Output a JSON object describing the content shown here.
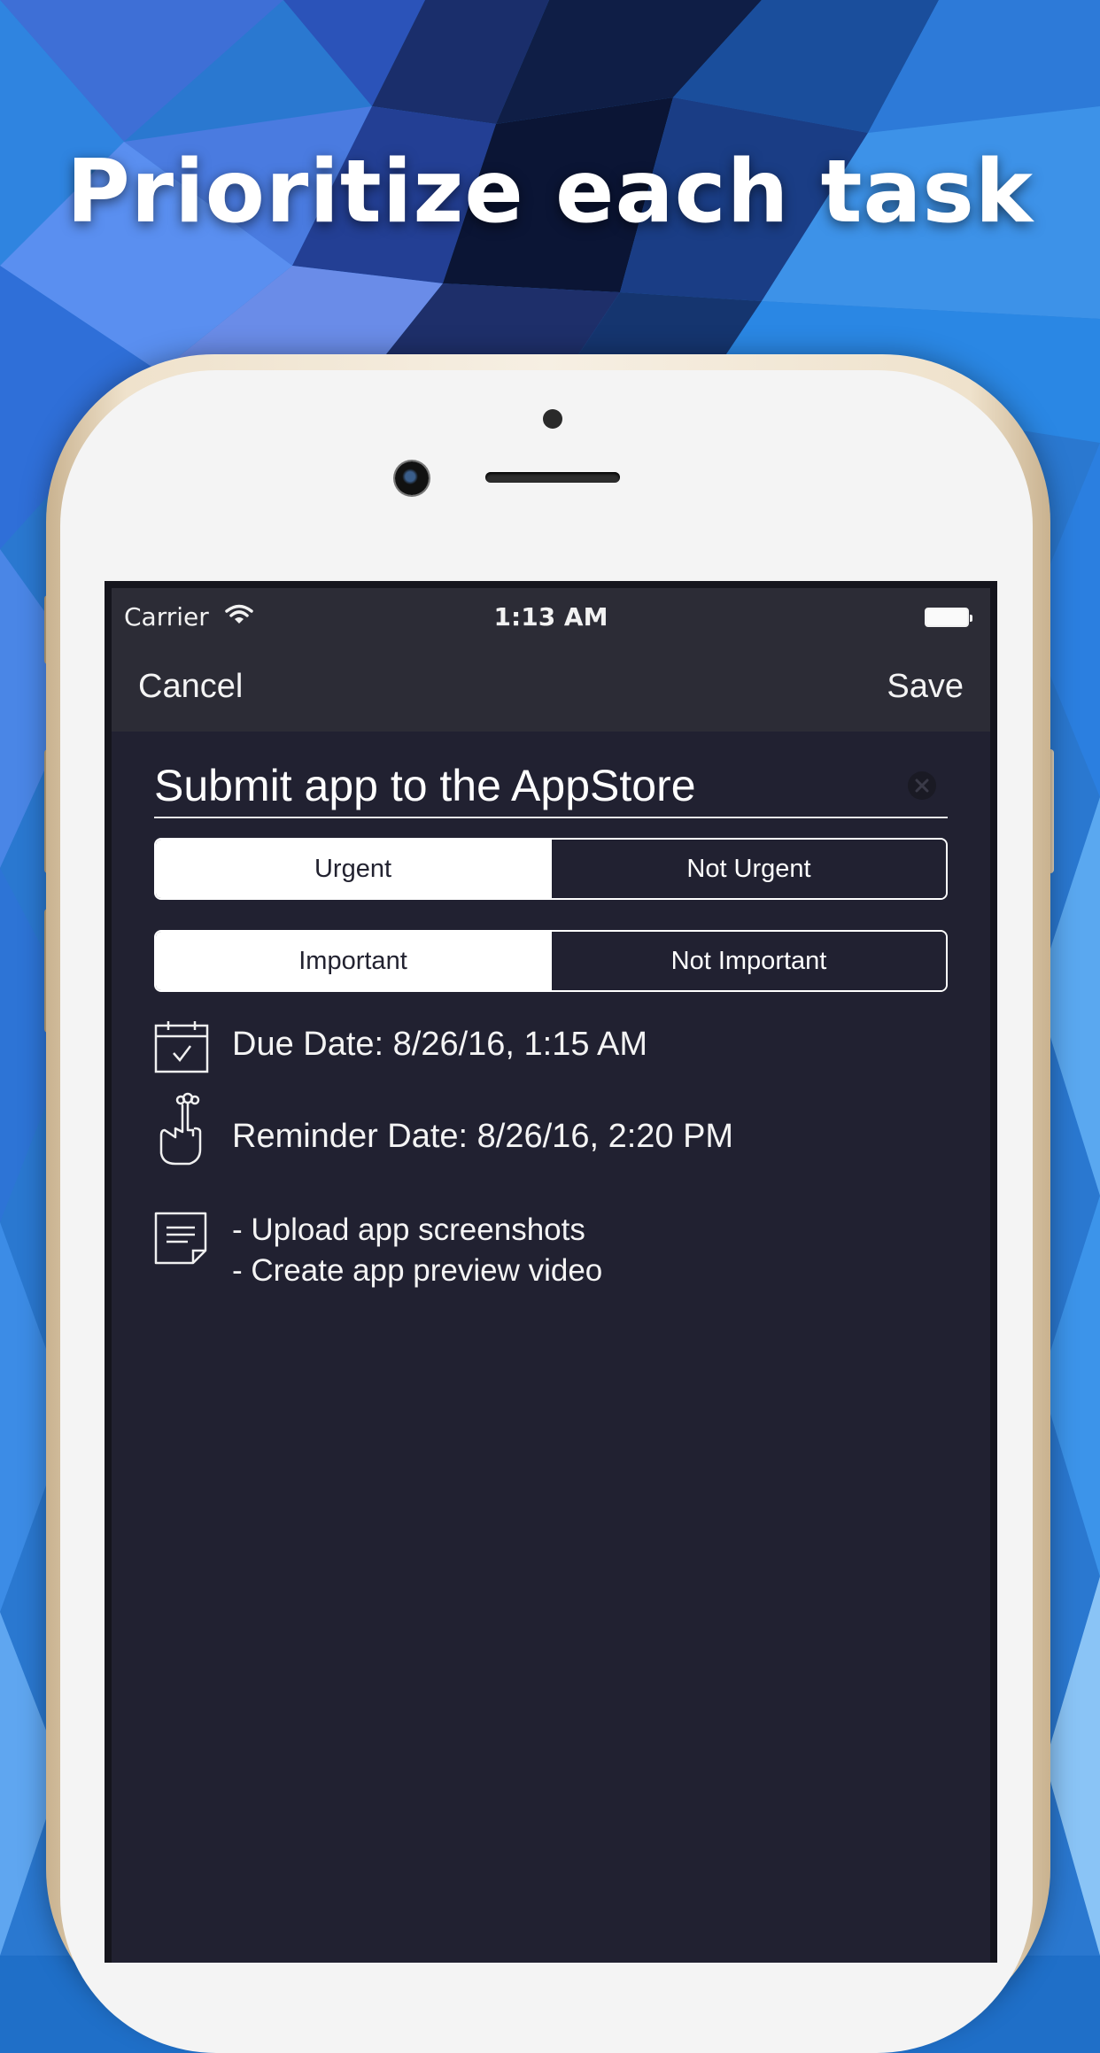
{
  "headline": "Prioritize each task",
  "status_bar": {
    "carrier": "Carrier",
    "time": "1:13 AM"
  },
  "nav": {
    "cancel_label": "Cancel",
    "save_label": "Save"
  },
  "task": {
    "title": "Submit app to the AppStore"
  },
  "urgency": {
    "options": [
      "Urgent",
      "Not Urgent"
    ],
    "selected": "Urgent"
  },
  "importance": {
    "options": [
      "Important",
      "Not Important"
    ],
    "selected": "Important"
  },
  "due_date": "Due Date: 8/26/16, 1:15 AM",
  "reminder_date": "Reminder Date: 8/26/16, 2:20 PM",
  "notes": [
    "- Upload app screenshots",
    "- Create app preview video"
  ],
  "icons": {
    "status": [
      "wifi-icon",
      "battery-icon"
    ],
    "rows": [
      "calendar-icon",
      "reminder-hand-icon",
      "notes-icon"
    ],
    "field": "clear-icon"
  },
  "colors": {
    "screen_bg": "#212131",
    "bar_bg": "#2c2c36",
    "text": "#ffffff",
    "background_blue": "#1f6fc8"
  }
}
